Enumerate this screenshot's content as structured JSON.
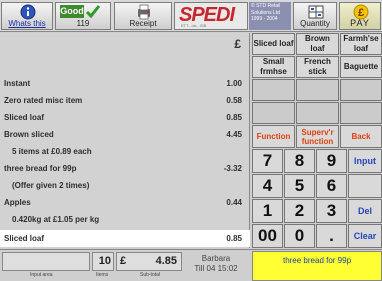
{
  "toolbar": {
    "whats_this": "Whats this",
    "good_badge": "Good",
    "good_count": "119",
    "receipt": "Receipt",
    "logo": "SPEDI",
    "logo_subtext": "ETT...ols...SIB",
    "copyright_lines": [
      "© STD Retail",
      "Solutions Ltd",
      "1999 - 2004"
    ],
    "quantity": "Quantity",
    "pay": "PAY"
  },
  "receipt": {
    "currency_symbol": "£",
    "lines": [
      {
        "desc": "Instant",
        "amount": "1.00"
      },
      {
        "desc": "Zero rated misc item",
        "amount": "0.58"
      },
      {
        "desc": "Sliced loaf",
        "amount": "0.85"
      },
      {
        "desc": "Brown sliced",
        "amount": "4.45"
      },
      {
        "desc": "5 items at £0.89 each",
        "amount": ""
      },
      {
        "desc": "three bread for 99p",
        "amount": "-3.32"
      },
      {
        "desc": "(Offer given 2 times)",
        "amount": ""
      },
      {
        "desc": "Apples",
        "amount": "0.44"
      },
      {
        "desc": "0.420kg at £1.05 per kg",
        "amount": ""
      },
      {
        "desc": "Sliced loaf",
        "amount": "0.85"
      }
    ]
  },
  "product_keys": {
    "sliced_loaf": "Sliced loaf",
    "brown_loaf": "Brown loaf",
    "farmhse_loaf": "Farmh'se loaf",
    "small_frmhse": "Small frmhse",
    "french_stick": "French stick",
    "baguette": "Baguette"
  },
  "function_keys": {
    "function": "Function",
    "supervisor": "Superv'r function",
    "back": "Back"
  },
  "keypad": {
    "seven": "7",
    "eight": "8",
    "nine": "9",
    "four": "4",
    "five": "5",
    "six": "6",
    "one": "1",
    "two": "2",
    "three": "3",
    "double_zero": "00",
    "zero": "0",
    "dot": ".",
    "input": "Input",
    "del": "Del",
    "clear": "Clear"
  },
  "status": {
    "input_area_value": "",
    "input_area_caption": "Input area",
    "items_value": "10",
    "items_caption": "Items",
    "subtotal_currency": "£",
    "subtotal_value": "4.85",
    "subtotal_caption": "Sub-total",
    "operator": "Barbara",
    "till_time": "Till 04  15:02",
    "message": "three bread for 99p"
  },
  "colors": {
    "accent_blue": "#2546b8",
    "function_orange": "#e0410f",
    "message_yellow": "#ffff33",
    "good_green": "#3d8b2e",
    "logo_red": "#c4282d"
  }
}
